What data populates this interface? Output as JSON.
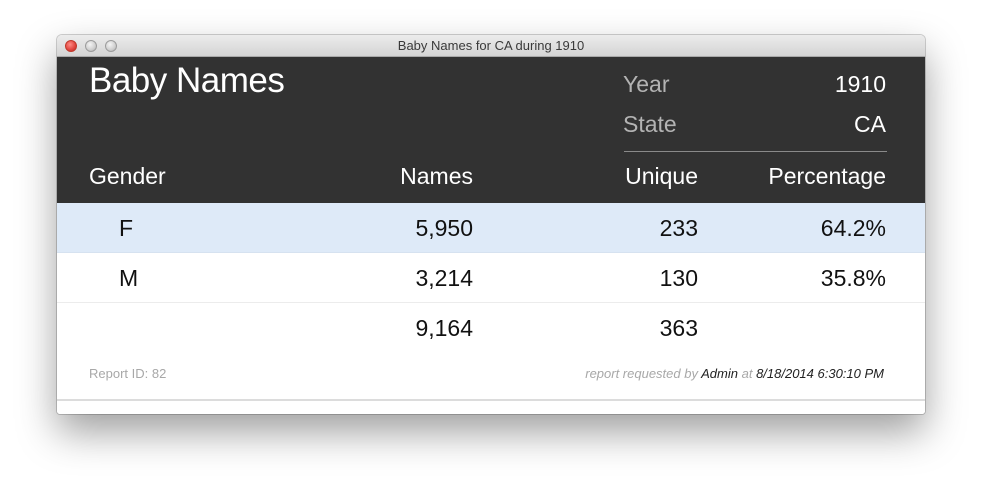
{
  "window": {
    "title": "Baby Names for CA during 1910"
  },
  "header": {
    "app_title": "Baby Names",
    "year_label": "Year",
    "year_value": "1910",
    "state_label": "State",
    "state_value": "CA"
  },
  "columns": {
    "gender": "Gender",
    "names": "Names",
    "unique": "Unique",
    "percentage": "Percentage"
  },
  "rows": [
    {
      "gender": "F",
      "names": "5,950",
      "unique": "233",
      "percentage": "64.2%"
    },
    {
      "gender": "M",
      "names": "3,214",
      "unique": "130",
      "percentage": "35.8%"
    }
  ],
  "totals": {
    "names": "9,164",
    "unique": "363"
  },
  "footer": {
    "report_id": "Report ID: 82",
    "requested_prefix": "report requested by",
    "requested_user": "Admin",
    "requested_at_word": "at",
    "requested_timestamp": "8/18/2014 6:30:10 PM"
  },
  "colors": {
    "header_bg": "#323232",
    "selected_row_bg": "#deeaf8",
    "close_button": "#e0443e"
  }
}
